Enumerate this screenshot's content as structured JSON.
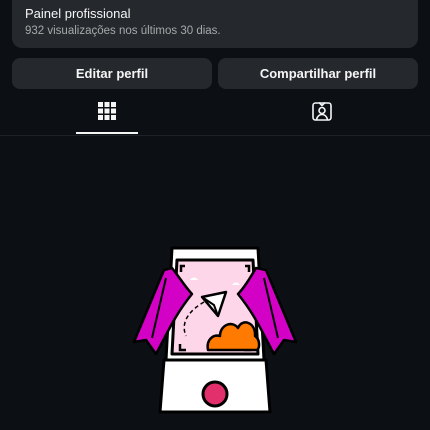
{
  "dashboard": {
    "title": "Painel profissional",
    "subtitle": "932 visualizações nos últimos 30 dias."
  },
  "actions": {
    "edit_label": "Editar perfil",
    "share_label": "Compartilhar perfil"
  },
  "tabs": [
    {
      "icon": "grid-icon",
      "selected": true
    },
    {
      "icon": "tagged-person-icon",
      "selected": false
    }
  ],
  "illustration": {
    "icon": "camera-curtains-illustration"
  },
  "colors": {
    "background": "#0c1014",
    "surface": "#25292e",
    "text_primary": "#f5f5f5",
    "text_secondary": "#a8a8a8",
    "magenta": "#d300c5",
    "orange": "#ff7a00",
    "pink": "#fdd6e9",
    "shutter": "#e1306c"
  }
}
